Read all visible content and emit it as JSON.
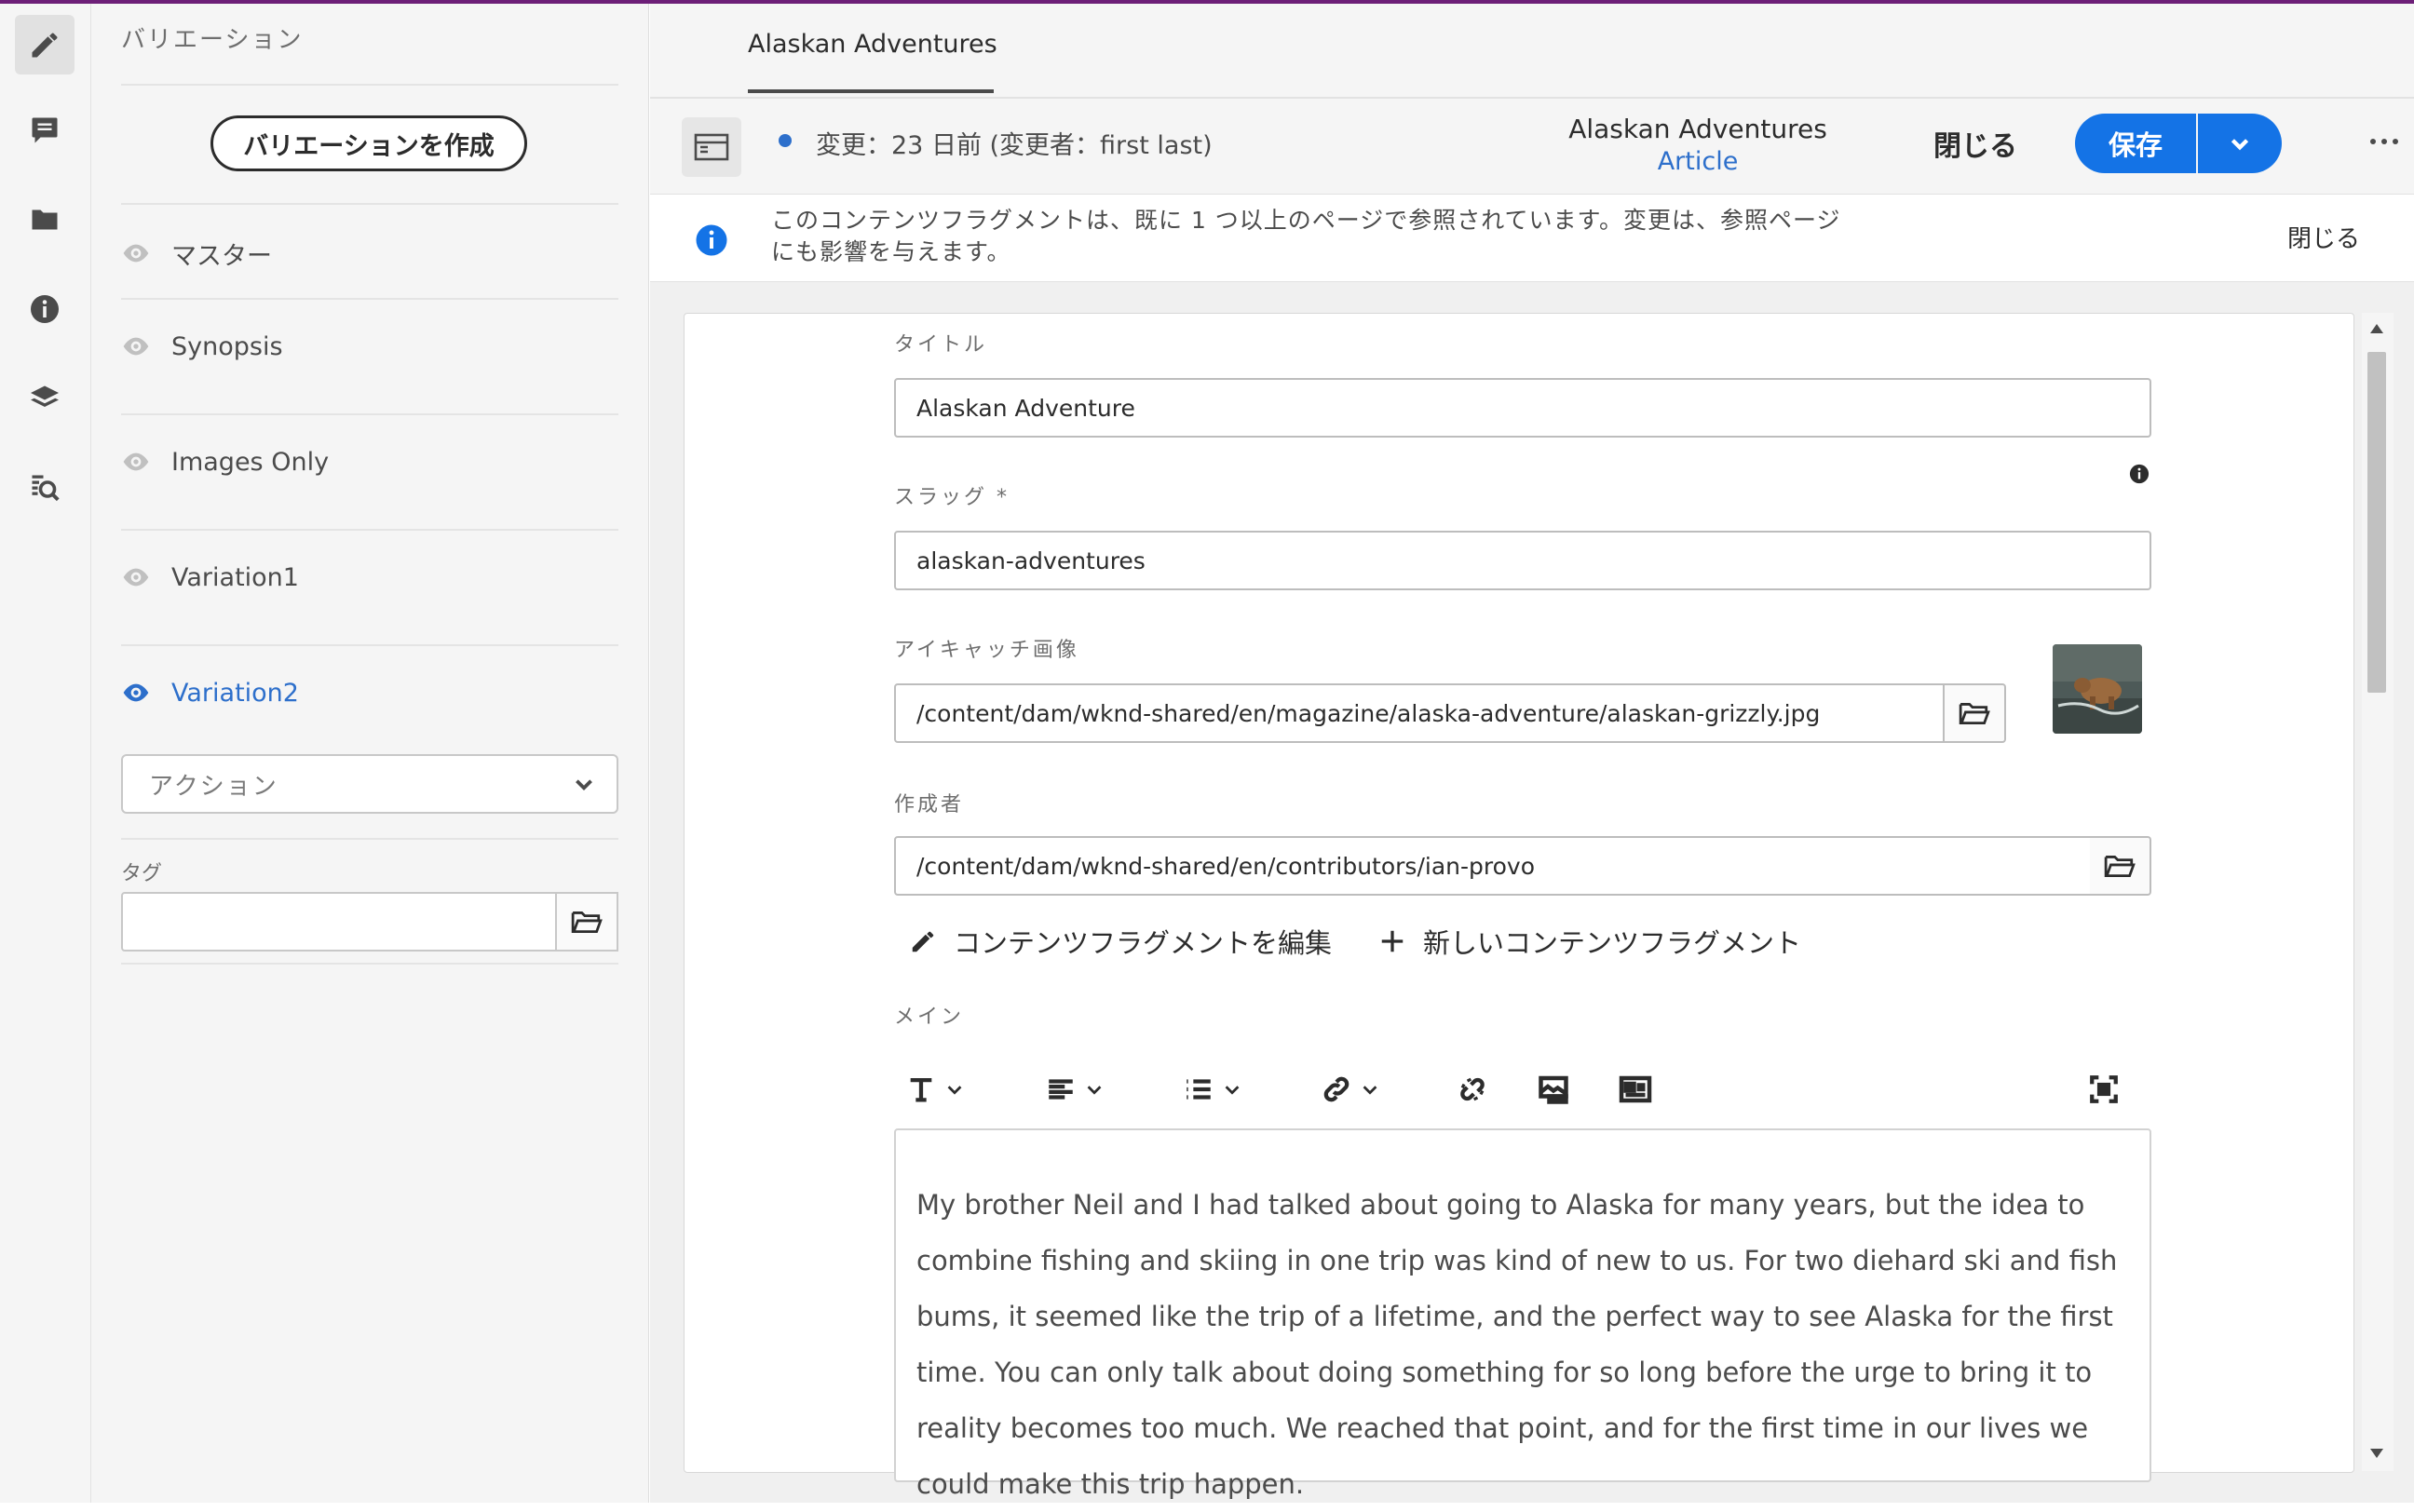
{
  "variations_panel": {
    "title": "バリエーション",
    "create_button": "バリエーションを作成",
    "items": [
      {
        "label": "マスター",
        "selected": false
      },
      {
        "label": "Synopsis",
        "selected": false
      },
      {
        "label": "Images Only",
        "selected": false
      },
      {
        "label": "Variation1",
        "selected": false
      },
      {
        "label": "Variation2",
        "selected": true
      }
    ],
    "action_select": "アクション",
    "tag_label": "タグ",
    "tag_value": ""
  },
  "tab": {
    "label": "Alaskan Adventures"
  },
  "header": {
    "status": "変更：23 日前 (変更者：first last)",
    "title": "Alaskan Adventures",
    "model": "Article",
    "close": "閉じる",
    "save": "保存"
  },
  "banner": {
    "text": "このコンテンツフラグメントは、既に 1 つ以上のページで参照されています。変更は、参照ページにも影響を与えます。",
    "close": "閉じる"
  },
  "form": {
    "title_label": "タイトル",
    "title_value": "Alaskan Adventure",
    "slug_label": "スラッグ *",
    "slug_value": "alaskan-adventures",
    "image_label": "アイキャッチ画像",
    "image_value": "/content/dam/wknd-shared/en/magazine/alaska-adventure/alaskan-grizzly.jpg",
    "author_label": "作成者",
    "author_value": "/content/dam/wknd-shared/en/contributors/ian-provo",
    "edit_fragment": "コンテンツフラグメントを編集",
    "new_fragment": "新しいコンテンツフラグメント",
    "main_label": "メイン",
    "main_text": "My brother Neil and I had talked about going to Alaska for many years, but the idea to combine fishing and skiing in one trip was kind of new to us. For two diehard ski and fish bums, it seemed like the trip of a lifetime, and the perfect way to see Alaska for the first time. You can only talk about doing something for so long before the urge to bring it to reality becomes too much. We reached that point, and for the first time in our lives we could make this trip happen."
  },
  "colors": {
    "accent": "#1473e6",
    "selected": "#2d6fcb",
    "top_line": "#6d1f78"
  },
  "icons": {
    "rail": [
      "pencil-icon",
      "comment-icon",
      "folder-icon",
      "info-icon",
      "layers-icon",
      "search-assets-icon"
    ]
  }
}
